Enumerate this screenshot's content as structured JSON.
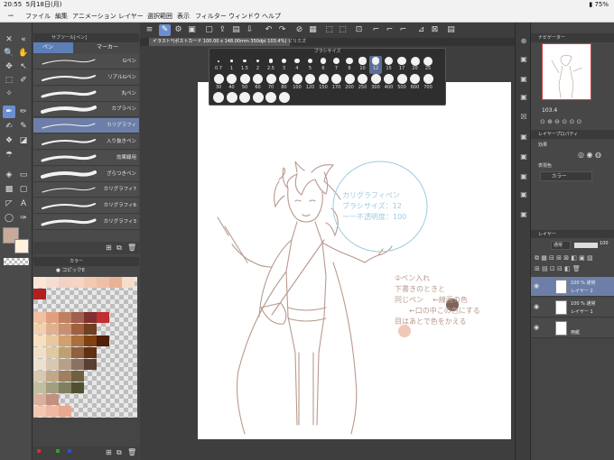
{
  "status": {
    "time": "20:55",
    "date": "5月18日(月)",
    "battery": "75%"
  },
  "menu": [
    "ファイル",
    "編集",
    "アニメーション",
    "レイヤー",
    "選択範囲",
    "表示",
    "フィルター",
    "ウィンドウ",
    "ヘルプ"
  ],
  "subtool": {
    "header": "サブツール[ペン]",
    "tabs": [
      "ペン",
      "マーカー"
    ],
    "brushes": [
      "Gペン",
      "リアルGペン",
      "丸ペン",
      "カブラペン",
      "カリグラフィ",
      "入り抜きペン",
      "効果線用",
      "ざらつきペン",
      "カリグラフィ7",
      "カリグラフィ6",
      "カリグラフィ3"
    ],
    "selected_index": 4
  },
  "colorset": {
    "header": "カラー",
    "set_name": "コピックE"
  },
  "doc_tabs": [
    "イラスト*(ポストカード 100.00 x 148.00mm 350dpi 103.4%)",
    "ピリミズ"
  ],
  "brush_size": {
    "title": "ブラシサイズ",
    "sizes_row1": [
      "0.7",
      "1",
      "1.5",
      "2",
      "2.5",
      "3",
      "4",
      "5",
      "6",
      "7",
      "8",
      "10",
      "12",
      "15",
      "17",
      "20",
      "25"
    ],
    "sizes_row2": [
      "30",
      "40",
      "50",
      "60",
      "70",
      "80",
      "100",
      "120",
      "150",
      "170",
      "200",
      "250",
      "300",
      "400",
      "500",
      "600",
      "700"
    ],
    "selected": "12"
  },
  "canvas": {
    "note1_lines": [
      "カリグラフィペン",
      "ブラシサイズ：12",
      "ー一不透明度：100"
    ],
    "note2_lines": [
      "②ペン入れ",
      "下書きのときと",
      "同じペン",
      "←線画の色",
      "←口の中この色にする",
      "目はあとで色をかえる"
    ]
  },
  "navigator": {
    "header": "ナビゲーター",
    "zoom": "103.4"
  },
  "layerprop": {
    "header": "レイヤープロパティ",
    "effect_label": "効果",
    "expression_label": "表現色",
    "expression_value": "カラー"
  },
  "layers": {
    "header": "レイヤー",
    "blend": "通常",
    "opacity": "100",
    "items": [
      {
        "mode": "100 % 通常",
        "name": "レイヤー 2"
      },
      {
        "mode": "100 % 通常",
        "name": "レイヤー 1"
      },
      {
        "mode": "",
        "name": "用紙"
      }
    ]
  },
  "colors": {
    "accent": "#6a8fd0",
    "sketch": "#b89a8e",
    "note_blue": "#9ecbe0",
    "main_color": "#c8a99a"
  }
}
